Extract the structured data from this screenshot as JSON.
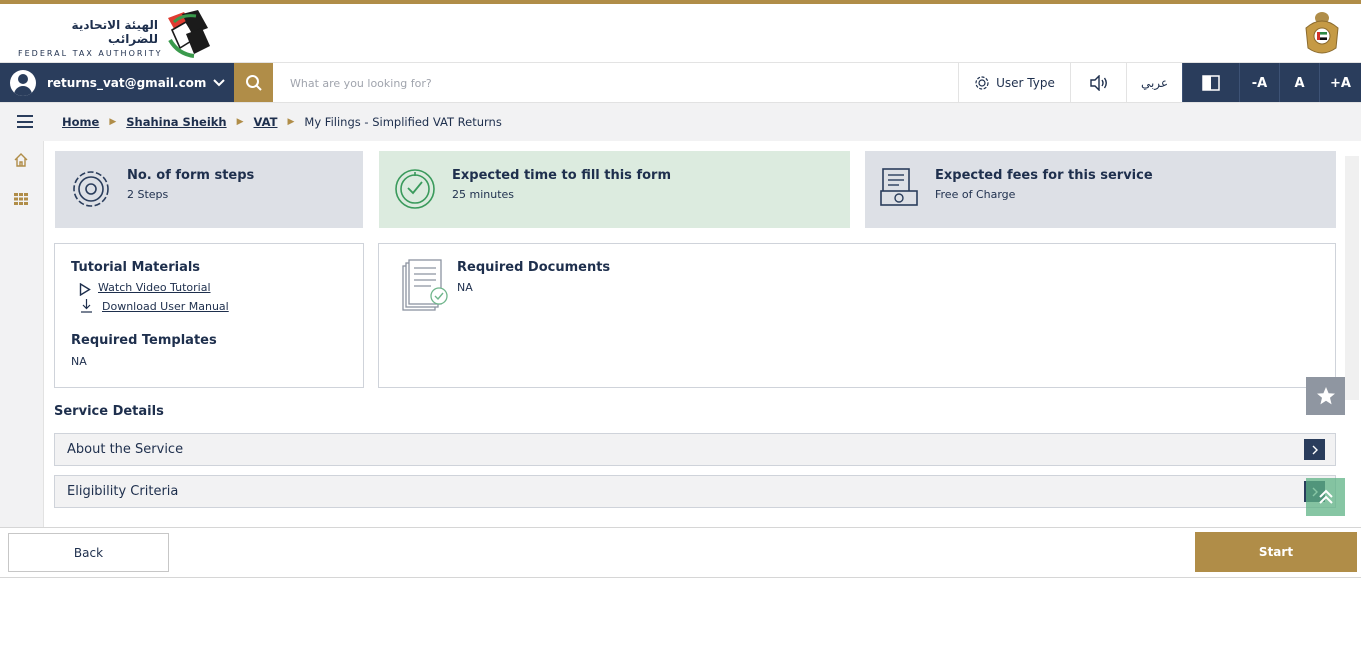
{
  "brand": {
    "arabic_name": "الهيئة الاتحادية للضرائب",
    "english_name": "FEDERAL TAX AUTHORITY"
  },
  "nav": {
    "user_email": "returns_vat@gmail.com",
    "search_placeholder": "What are you looking for?",
    "user_type_label": "User Type",
    "language_label": "عربي",
    "font_decrease": "-A",
    "font_normal": "A",
    "font_increase": "+A"
  },
  "breadcrumb": {
    "items": [
      "Home",
      "Shahina Sheikh",
      "VAT"
    ],
    "current": "My Filings - Simplified VAT Returns"
  },
  "info_cards": [
    {
      "title": "No. of form steps",
      "value": "2 Steps",
      "icon": "gear-icon"
    },
    {
      "title": "Expected time to fill this form",
      "value": "25 minutes",
      "icon": "clock-icon"
    },
    {
      "title": "Expected fees for this service",
      "value": "Free of Charge",
      "icon": "receipt-icon"
    }
  ],
  "tutorial": {
    "heading": "Tutorial Materials",
    "video_link": "Watch Video Tutorial",
    "manual_link": "Download User Manual",
    "templates_heading": "Required Templates",
    "templates_value": "NA"
  },
  "required_documents": {
    "heading": "Required Documents",
    "value": "NA"
  },
  "service_details": {
    "heading": "Service Details",
    "sections": [
      "About the Service",
      "Eligibility Criteria"
    ]
  },
  "footer": {
    "back_label": "Back",
    "start_label": "Start"
  },
  "colors": {
    "navy": "#2a3d5c",
    "gold": "#b08d48",
    "steps_bg": "#dde0e6",
    "time_bg": "#dcebdf"
  }
}
